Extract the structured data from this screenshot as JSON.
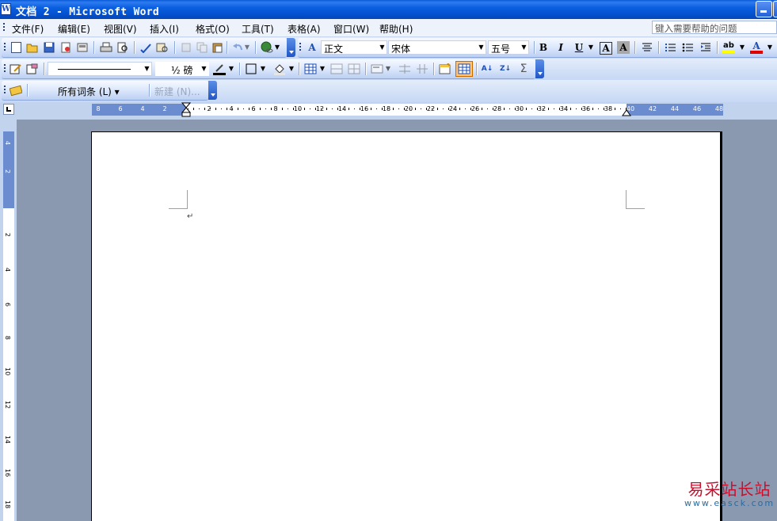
{
  "window": {
    "title": "文档 2 - Microsoft Word",
    "app_icon_letter": "W"
  },
  "menubar": {
    "items": [
      "文件(F)",
      "编辑(E)",
      "视图(V)",
      "插入(I)",
      "格式(O)",
      "工具(T)",
      "表格(A)",
      "窗口(W)",
      "帮助(H)"
    ],
    "help_placeholder": "键入需要帮助的问题"
  },
  "formatting": {
    "style": "正文",
    "font": "宋体",
    "size": "五号",
    "bold_label": "B",
    "italic_label": "I",
    "underline_label": "U",
    "char_border_label": "A",
    "char_shading_label": "A",
    "font_color_label": "A",
    "highlight_label": "ab"
  },
  "tables_borders": {
    "line_weight": "½ 磅",
    "sum_label": "Σ"
  },
  "reviewing": {
    "all_entries": "所有词条 (L) ▾",
    "new_entry": "新建 (N)..."
  },
  "ruler": {
    "horizontal_labels": [
      "8",
      "6",
      "4",
      "2",
      "",
      "2",
      "4",
      "6",
      "8",
      "10",
      "12",
      "14",
      "16",
      "18",
      "20",
      "22",
      "24",
      "26",
      "28",
      "30",
      "32",
      "34",
      "36",
      "38",
      "40",
      "42",
      "44",
      "46",
      "48"
    ],
    "vertical_labels": [
      "4",
      "2",
      "",
      "2",
      "4",
      "6",
      "8",
      "10",
      "12",
      "14",
      "16",
      "18"
    ]
  },
  "document": {
    "paragraph_mark": "↵"
  },
  "watermark": {
    "text_cn": "易采站长站",
    "text_en": "www.easck.com"
  },
  "colors": {
    "titlebar": "#0a5fe0",
    "toolbar": "#dbe7fb",
    "ruler_margin": "#6b8ccf",
    "workspace": "#8a98b0",
    "highlight_yellow": "#ffff00",
    "font_color_red": "#e00000"
  }
}
